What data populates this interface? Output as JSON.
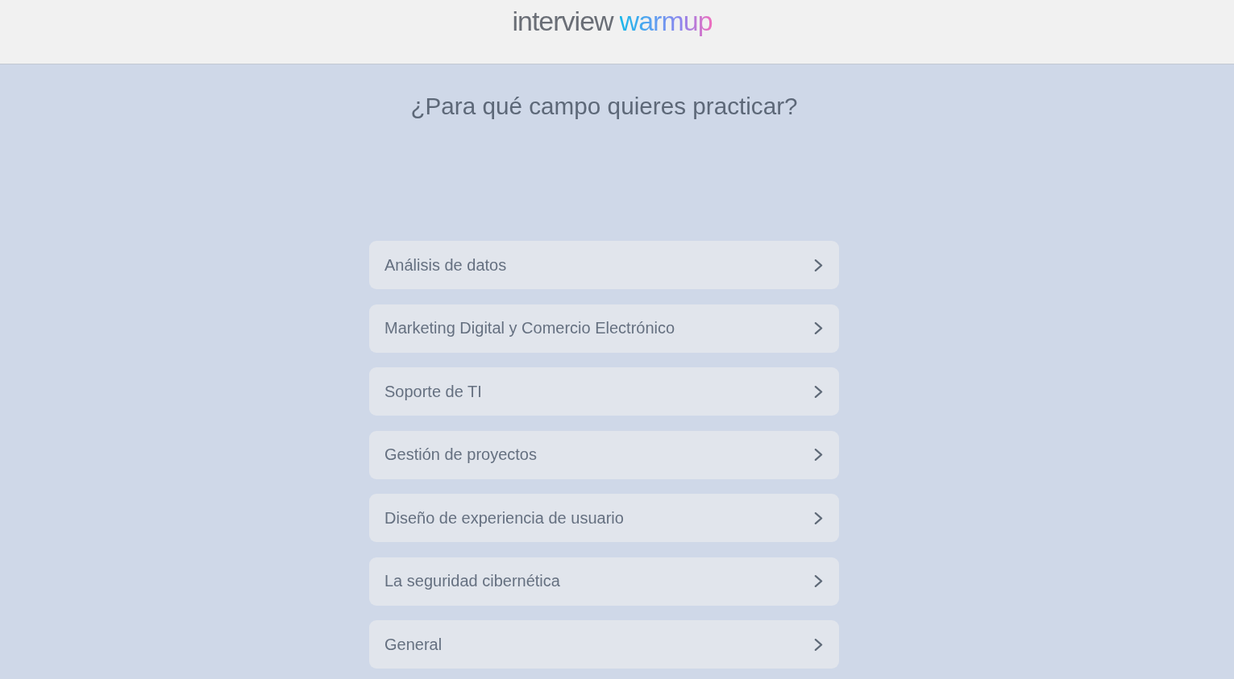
{
  "header": {
    "logo": {
      "text": "interview",
      "accent": "warmup"
    }
  },
  "heading": "¿Para qué campo quieres practicar?",
  "fields": [
    {
      "label": "Análisis de datos"
    },
    {
      "label": "Marketing Digital y Comercio Electrónico"
    },
    {
      "label": "Soporte de TI"
    },
    {
      "label": "Gestión de proyectos"
    },
    {
      "label": "Diseño de experiencia de usuario"
    },
    {
      "label": "La seguridad cibernética"
    },
    {
      "label": "General"
    }
  ]
}
